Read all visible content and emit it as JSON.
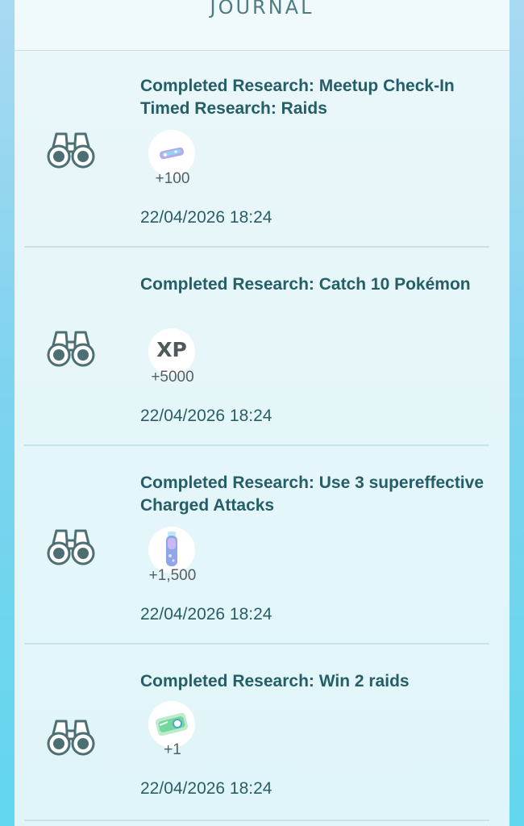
{
  "header": {
    "title": "JOURNAL"
  },
  "entries": [
    {
      "title": "Completed Research: Meetup Check-In Timed Research: Raids",
      "reward_icon": "stardust-icon",
      "reward_amount": "+100",
      "timestamp": "22/04/2026 18:24"
    },
    {
      "title": "Completed Research: Catch 10 Pokémon",
      "reward_icon": "xp-icon",
      "reward_label": "XP",
      "reward_amount": "+5000",
      "timestamp": "22/04/2026 18:24"
    },
    {
      "title": "Completed Research: Use 3 supereffective Charged Attacks",
      "reward_icon": "potion-icon",
      "reward_amount": "+1,500",
      "timestamp": "22/04/2026 18:24"
    },
    {
      "title": "Completed Research: Win 2 raids",
      "reward_icon": "raid-pass-icon",
      "reward_amount": "+1",
      "timestamp": "22/04/2026 18:24"
    }
  ],
  "colors": {
    "title": "#245e66",
    "timestamp": "#2a5e66",
    "reward_amount": "#555f62",
    "icon": "#4c6f73"
  }
}
